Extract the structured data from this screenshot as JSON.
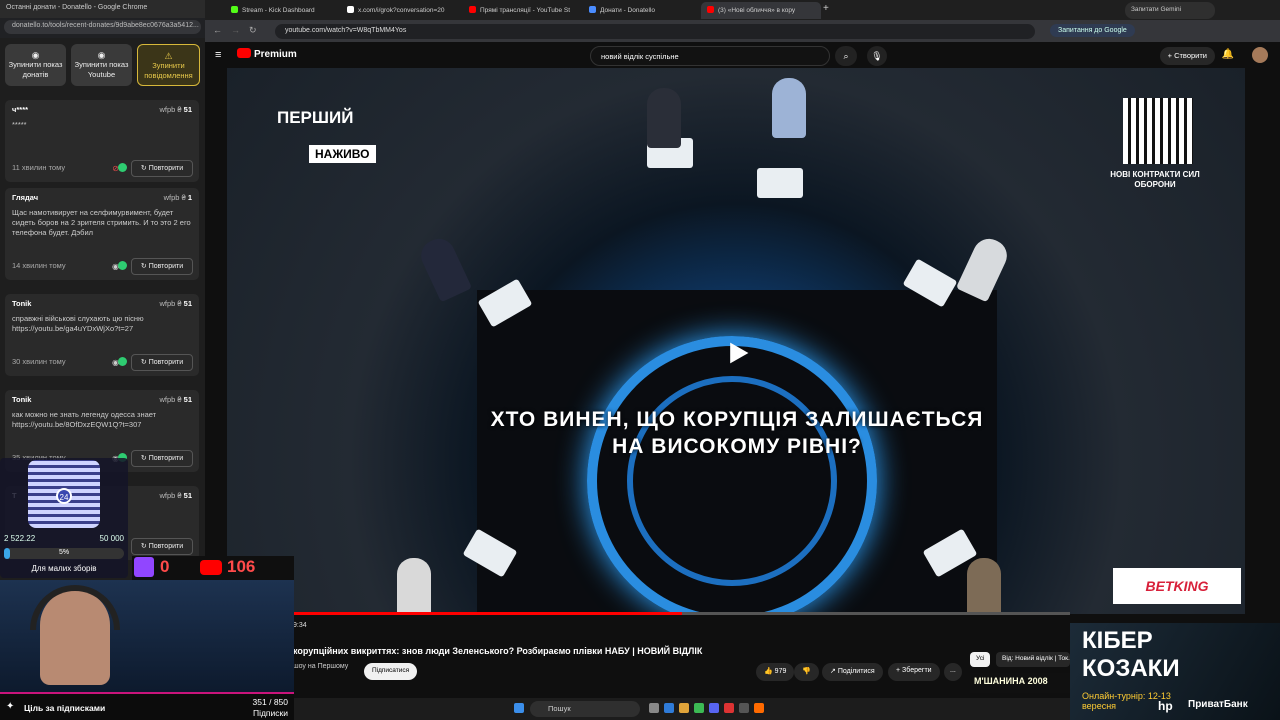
{
  "left_window": {
    "title": "Останні донати - Donatello - Google Chrome",
    "url": "donatello.to/tools/recent-donates/9d9abe8ec0676a3a5412...",
    "stop_buttons": [
      {
        "icon": "stop-circle-icon",
        "label": "Зупинити показ донатів"
      },
      {
        "icon": "stop-circle-icon",
        "label": "Зупинити показ Youtube"
      },
      {
        "icon": "warning-icon",
        "label": "Зупинити повідомлення"
      }
    ],
    "repeat_label": "Повторити",
    "donations": [
      {
        "name": "ч****",
        "platform": "wfpb",
        "amount": "51",
        "message": "*****",
        "time": "11 хвилин тому",
        "visibility": "eye-off-icon"
      },
      {
        "name": "Глядач",
        "platform": "wfpb",
        "amount": "1",
        "message": "Щас намотивирует на селфимурвимент, будет сидеть боров на 2 зрителя стримить. И то это 2 его телефона будет. Дэбил",
        "time": "14 хвилин тому",
        "visibility": "eye-icon"
      },
      {
        "name": "Tonik",
        "platform": "wfpb",
        "amount": "51",
        "message": "справжні військові слухають цю пісню https://youtu.be/ga4uYDxWjXo?t=27",
        "time": "30 хвилин тому",
        "visibility": "eye-icon"
      },
      {
        "name": "Tonik",
        "platform": "wfpb",
        "amount": "51",
        "message": "как можно не знать легенду одесса знает https://youtu.be/8OfDxzEQW1Q?t=307",
        "time": "35 хвилин тому",
        "visibility": "eye-icon"
      },
      {
        "name": "T",
        "platform": "wfpb",
        "amount": "51",
        "message": "",
        "time": "",
        "visibility": "eye-icon"
      }
    ]
  },
  "tabs": [
    {
      "label": "Stream - Kick Dashboard",
      "color": "#53fc18"
    },
    {
      "label": "x.com/i/grok?conversation=20",
      "color": "#ffffff"
    },
    {
      "label": "Прямі трансляції - YouTube St",
      "color": "#ff0000"
    },
    {
      "label": "Донати - Donatello",
      "color": "#4a8cff"
    },
    {
      "label": "(3) «Нові обличчя» в кору",
      "color": "#ff0000"
    }
  ],
  "address": {
    "url": "youtube.com/watch?v=W8qTbMM4Yos",
    "gemini": "Запитання до Google",
    "ask_gemini": "Запитати Gemini"
  },
  "youtube": {
    "logo": "Premium",
    "search_value": "новий відлік суспільне",
    "create_label": "Створити",
    "notification_count": "3"
  },
  "video": {
    "channel_logo": "ПЕРШИЙ",
    "live_badge": "НАЖИВО",
    "question": "ХТО ВИНЕН, ЩО КОРУПЦІЯ ЗАЛИШАЄТЬСЯ НА ВИСОКОМУ РІВНІ?",
    "qr_caption": "НОВІ КОНТРАКТИ СИЛ ОБОРОНИ",
    "sponsor": "BETKING",
    "progress": 0.5,
    "time": "9:34"
  },
  "below": {
    "title": "корупційних викриттях: знов люди Зеленського? Розбираємо плівки НАБУ | НОВИЙ ВІДЛІК",
    "channel": "шоу на Першому",
    "subscribe": "Підписатися",
    "likes": "979",
    "share": "Поділитися",
    "save": "Зберегти",
    "more": "...",
    "categories": [
      "Усі",
      "Від: Новий відлік | Ток..."
    ]
  },
  "donation_goal": {
    "qr_number": "24",
    "raised": "2 522.22",
    "goal": "50 000",
    "percent": "5%",
    "percent_value": 5,
    "label": "Для малих зборів"
  },
  "counters": {
    "twitch": "0",
    "youtube": "106"
  },
  "subscriber_goal": {
    "label": "Ціль за підписками",
    "value": "351 / 850",
    "unit": "Підписки"
  },
  "ad": {
    "headline_1": "КІБЕР",
    "headline_2": "КОЗАКИ",
    "subtitle": "Онлайн-турнір: 12-13 вересня",
    "bank": "ПриватБанк"
  },
  "moshanina": "М'ШАНИНА 2008",
  "taskbar": {
    "search": "Пошук"
  }
}
